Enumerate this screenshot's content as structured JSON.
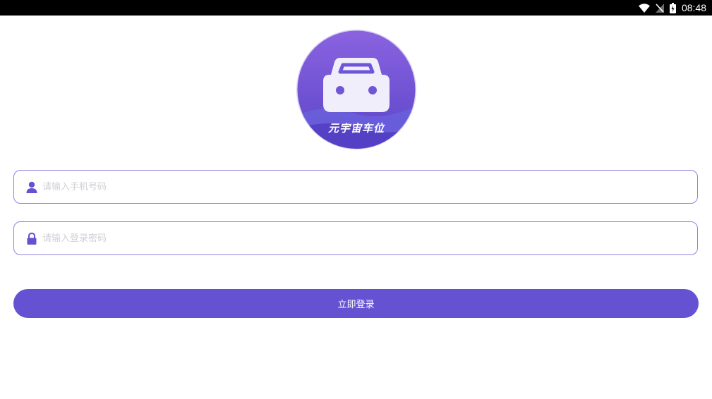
{
  "status_bar": {
    "time": "08:48",
    "icons": [
      "wifi-icon",
      "no-signal-icon",
      "battery-icon"
    ]
  },
  "app": {
    "name": "元宇宙车位",
    "logo_icon": "car-icon"
  },
  "form": {
    "phone": {
      "icon": "user-icon",
      "placeholder": "请输入手机号码",
      "value": ""
    },
    "password": {
      "icon": "lock-icon",
      "placeholder": "请输入登录密码",
      "value": ""
    },
    "submit_label": "立即登录"
  },
  "colors": {
    "accent": "#6552d3",
    "border": "#8d85df",
    "logo_gradient_top": "#8a63e0",
    "logo_gradient_bottom": "#5a45c8",
    "placeholder": "#cfcfd6"
  }
}
